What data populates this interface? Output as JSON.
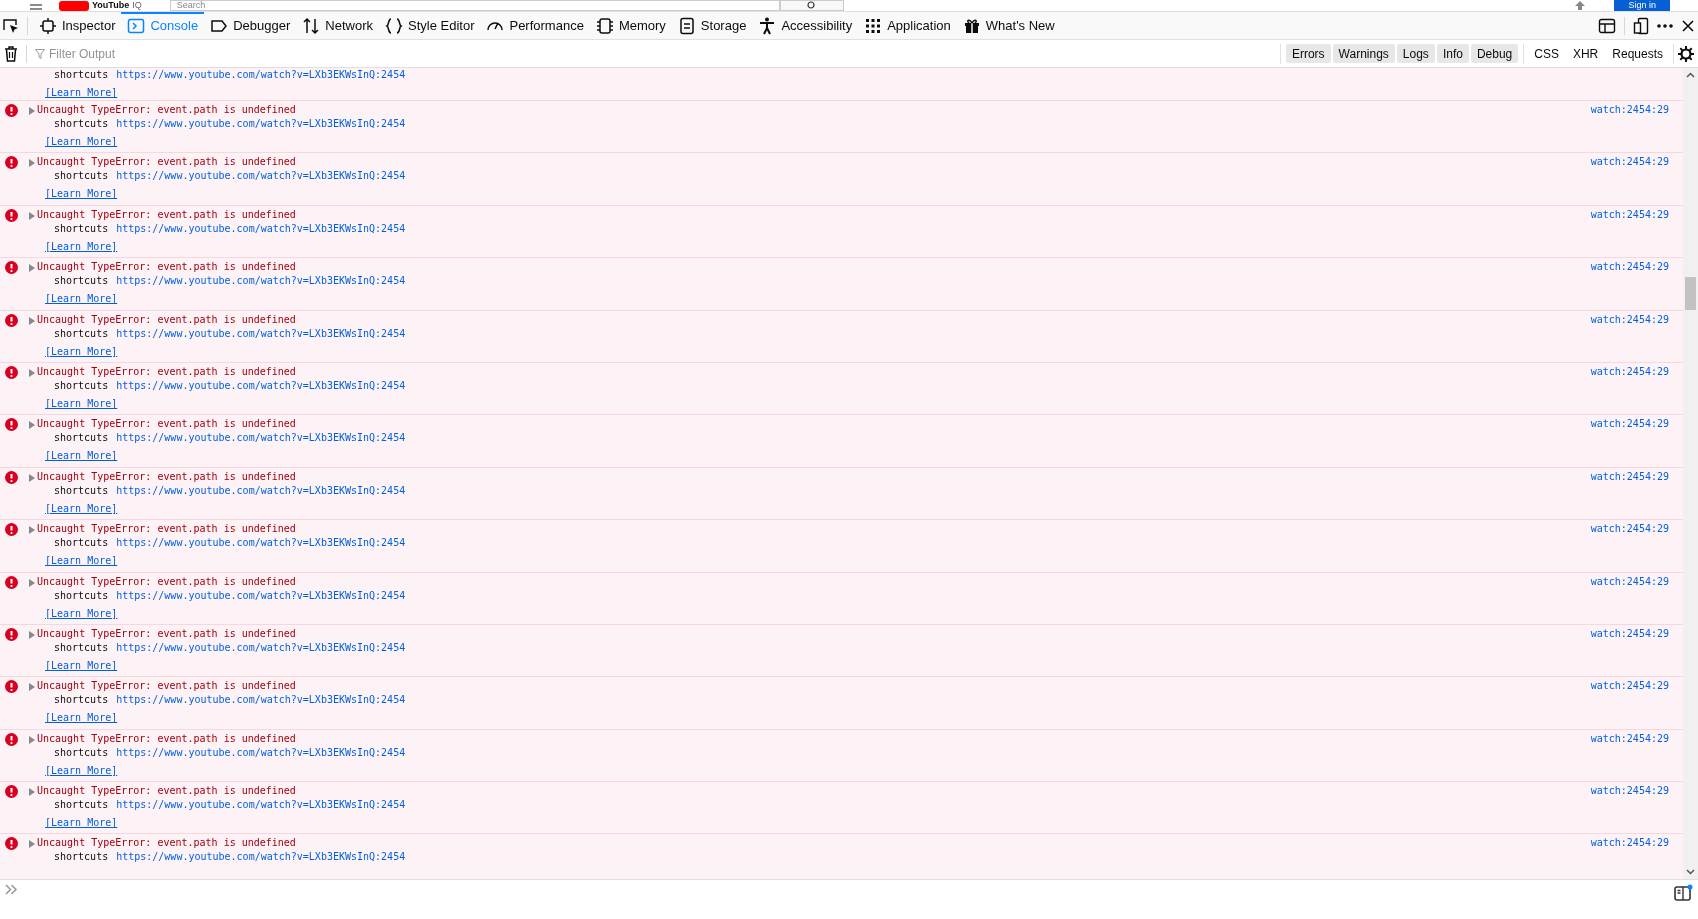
{
  "page_behind": {
    "logo": "YouTube",
    "logo_mark": "IQ",
    "search_placeholder": "Search",
    "sign_in": "Sign in"
  },
  "toolbar": {
    "tabs": [
      {
        "label": "Inspector",
        "selected": false
      },
      {
        "label": "Console",
        "selected": true
      },
      {
        "label": "Debugger",
        "selected": false
      },
      {
        "label": "Network",
        "selected": false
      },
      {
        "label": "Style Editor",
        "selected": false
      },
      {
        "label": "Performance",
        "selected": false
      },
      {
        "label": "Memory",
        "selected": false
      },
      {
        "label": "Storage",
        "selected": false
      },
      {
        "label": "Accessibility",
        "selected": false
      },
      {
        "label": "Application",
        "selected": false
      },
      {
        "label": "What's New",
        "selected": false
      }
    ]
  },
  "filter_bar": {
    "placeholder": "Filter Output",
    "levels": [
      {
        "label": "Errors",
        "selected": true
      },
      {
        "label": "Warnings",
        "selected": true
      },
      {
        "label": "Logs",
        "selected": true
      },
      {
        "label": "Info",
        "selected": true
      },
      {
        "label": "Debug",
        "selected": true
      }
    ],
    "types": [
      {
        "label": "CSS",
        "selected": false
      },
      {
        "label": "XHR",
        "selected": false
      },
      {
        "label": "Requests",
        "selected": false
      }
    ]
  },
  "messages": [
    {
      "function": "shortcuts",
      "url": "https://www.youtube.com/watch?v=LXb3EKWsInQ:2454",
      "learn_more": "[Learn More]"
    },
    {
      "text": "Uncaught TypeError: event.path is undefined",
      "function": "shortcuts",
      "url": "https://www.youtube.com/watch?v=LXb3EKWsInQ:2454",
      "learn_more": "[Learn More]",
      "location": "watch:2454:29"
    },
    {
      "text": "Uncaught TypeError: event.path is undefined",
      "function": "shortcuts",
      "url": "https://www.youtube.com/watch?v=LXb3EKWsInQ:2454",
      "learn_more": "[Learn More]",
      "location": "watch:2454:29"
    },
    {
      "text": "Uncaught TypeError: event.path is undefined",
      "function": "shortcuts",
      "url": "https://www.youtube.com/watch?v=LXb3EKWsInQ:2454",
      "learn_more": "[Learn More]",
      "location": "watch:2454:29"
    },
    {
      "text": "Uncaught TypeError: event.path is undefined",
      "function": "shortcuts",
      "url": "https://www.youtube.com/watch?v=LXb3EKWsInQ:2454",
      "learn_more": "[Learn More]",
      "location": "watch:2454:29"
    },
    {
      "text": "Uncaught TypeError: event.path is undefined",
      "function": "shortcuts",
      "url": "https://www.youtube.com/watch?v=LXb3EKWsInQ:2454",
      "learn_more": "[Learn More]",
      "location": "watch:2454:29"
    },
    {
      "text": "Uncaught TypeError: event.path is undefined",
      "function": "shortcuts",
      "url": "https://www.youtube.com/watch?v=LXb3EKWsInQ:2454",
      "learn_more": "[Learn More]",
      "location": "watch:2454:29"
    },
    {
      "text": "Uncaught TypeError: event.path is undefined",
      "function": "shortcuts",
      "url": "https://www.youtube.com/watch?v=LXb3EKWsInQ:2454",
      "learn_more": "[Learn More]",
      "location": "watch:2454:29"
    },
    {
      "text": "Uncaught TypeError: event.path is undefined",
      "function": "shortcuts",
      "url": "https://www.youtube.com/watch?v=LXb3EKWsInQ:2454",
      "learn_more": "[Learn More]",
      "location": "watch:2454:29"
    },
    {
      "text": "Uncaught TypeError: event.path is undefined",
      "function": "shortcuts",
      "url": "https://www.youtube.com/watch?v=LXb3EKWsInQ:2454",
      "learn_more": "[Learn More]",
      "location": "watch:2454:29"
    },
    {
      "text": "Uncaught TypeError: event.path is undefined",
      "function": "shortcuts",
      "url": "https://www.youtube.com/watch?v=LXb3EKWsInQ:2454",
      "learn_more": "[Learn More]",
      "location": "watch:2454:29"
    },
    {
      "text": "Uncaught TypeError: event.path is undefined",
      "function": "shortcuts",
      "url": "https://www.youtube.com/watch?v=LXb3EKWsInQ:2454",
      "learn_more": "[Learn More]",
      "location": "watch:2454:29"
    },
    {
      "text": "Uncaught TypeError: event.path is undefined",
      "function": "shortcuts",
      "url": "https://www.youtube.com/watch?v=LXb3EKWsInQ:2454",
      "learn_more": "[Learn More]",
      "location": "watch:2454:29"
    },
    {
      "text": "Uncaught TypeError: event.path is undefined",
      "function": "shortcuts",
      "url": "https://www.youtube.com/watch?v=LXb3EKWsInQ:2454",
      "learn_more": "[Learn More]",
      "location": "watch:2454:29"
    },
    {
      "text": "Uncaught TypeError: event.path is undefined",
      "function": "shortcuts",
      "url": "https://www.youtube.com/watch?v=LXb3EKWsInQ:2454",
      "learn_more": "[Learn More]",
      "location": "watch:2454:29"
    },
    {
      "text": "Uncaught TypeError: event.path is undefined",
      "function": "shortcuts",
      "url": "https://www.youtube.com/watch?v=LXb3EKWsInQ:2454",
      "location": "watch:2454:29"
    }
  ]
}
